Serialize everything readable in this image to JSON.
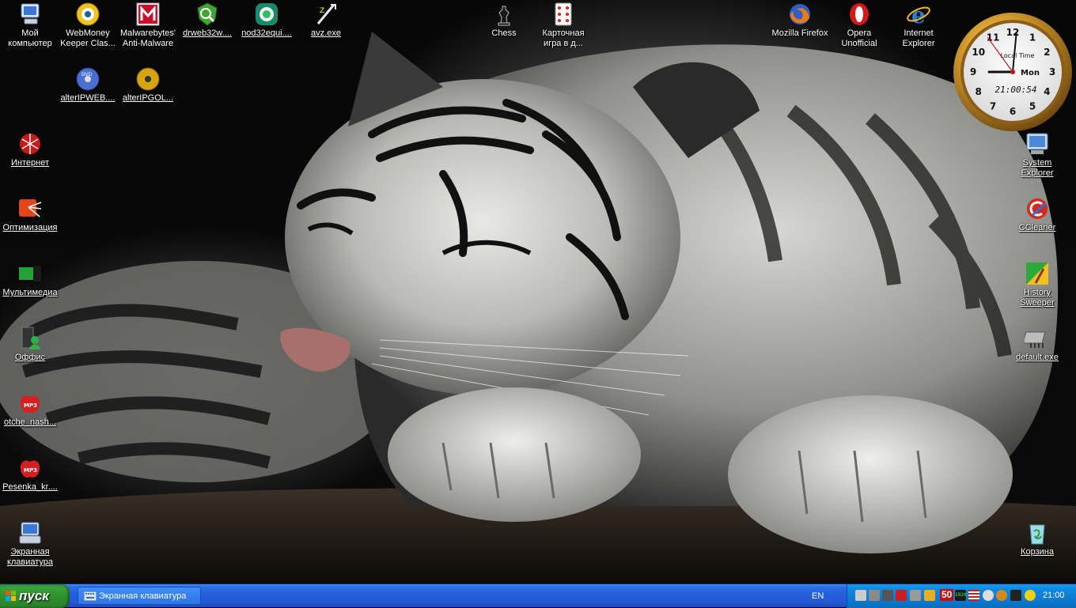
{
  "desktop": {
    "icons": [
      {
        "id": "my-computer",
        "label": "Мой компьютер",
        "glyph": "computer-icon"
      },
      {
        "id": "webmoney",
        "label": "WebMoney Keeper Clas...",
        "glyph": "webmoney-icon"
      },
      {
        "id": "malwarebytes",
        "label": "Malwarebytes' Anti-Malware",
        "glyph": "malwarebytes-icon"
      },
      {
        "id": "drweb",
        "label": "drweb32w....",
        "glyph": "drweb-icon"
      },
      {
        "id": "nod32",
        "label": "nod32equi....",
        "glyph": "nod32-icon"
      },
      {
        "id": "avz",
        "label": "avz.exe",
        "glyph": "avz-icon"
      },
      {
        "id": "chess",
        "label": "Chess",
        "glyph": "chess-icon"
      },
      {
        "id": "card-game",
        "label": "Карточная игра в д...",
        "glyph": "playing-card-icon"
      },
      {
        "id": "firefox",
        "label": "Mozilla Firefox",
        "glyph": "firefox-icon"
      },
      {
        "id": "opera",
        "label": "Opera Unofficial",
        "glyph": "opera-icon"
      },
      {
        "id": "ie",
        "label": "Internet Explorer",
        "glyph": "internet-explorer-icon"
      },
      {
        "id": "alteripweb",
        "label": "alterIPWEB....",
        "glyph": "dvd-icon"
      },
      {
        "id": "alteripgol",
        "label": "alterIPGOL...",
        "glyph": "gold-disc-icon"
      },
      {
        "id": "internet",
        "label": "Интернет",
        "glyph": "internet-folder-icon"
      },
      {
        "id": "optimization",
        "label": "Оптимизация",
        "glyph": "optimization-icon"
      },
      {
        "id": "multimedia",
        "label": "Мультимедиа",
        "glyph": "multimedia-icon"
      },
      {
        "id": "office",
        "label": "Оффис",
        "glyph": "office-icon"
      },
      {
        "id": "otche",
        "label": "otche_nash...",
        "glyph": "mp3-icon"
      },
      {
        "id": "pesenka",
        "label": "Pesenka_kr....",
        "glyph": "mp3-icon"
      },
      {
        "id": "osk",
        "label": "Экранная клавиатура",
        "glyph": "keyboard-icon"
      },
      {
        "id": "system-explorer",
        "label": "System Explorer",
        "glyph": "system-explorer-icon"
      },
      {
        "id": "ccleaner",
        "label": "CCleaner",
        "glyph": "ccleaner-icon"
      },
      {
        "id": "history-sweeper",
        "label": "History Sweeper",
        "glyph": "history-sweeper-icon"
      },
      {
        "id": "default-exe",
        "label": "default.exe",
        "glyph": "executable-icon"
      },
      {
        "id": "recycle-bin",
        "label": "Корзина",
        "glyph": "recycle-bin-icon"
      }
    ]
  },
  "clock_gadget": {
    "title": "Local Time",
    "day": "Mon",
    "digital": "21:00:54",
    "hour": 9,
    "minute": 0,
    "second": 54,
    "numerals": [
      "12",
      "1",
      "2",
      "3",
      "4",
      "5",
      "6",
      "7",
      "8",
      "9",
      "10",
      "11"
    ]
  },
  "taskbar": {
    "start_label": "пуск",
    "task_label": "Экранная клавиатура",
    "language": "EN",
    "tray_counter": "50",
    "tray_small_text": "1920",
    "time": "21:00"
  },
  "colors": {
    "taskbar_blue": "#245edb",
    "start_green": "#37a237",
    "tray_blue": "#0f8ae0"
  }
}
